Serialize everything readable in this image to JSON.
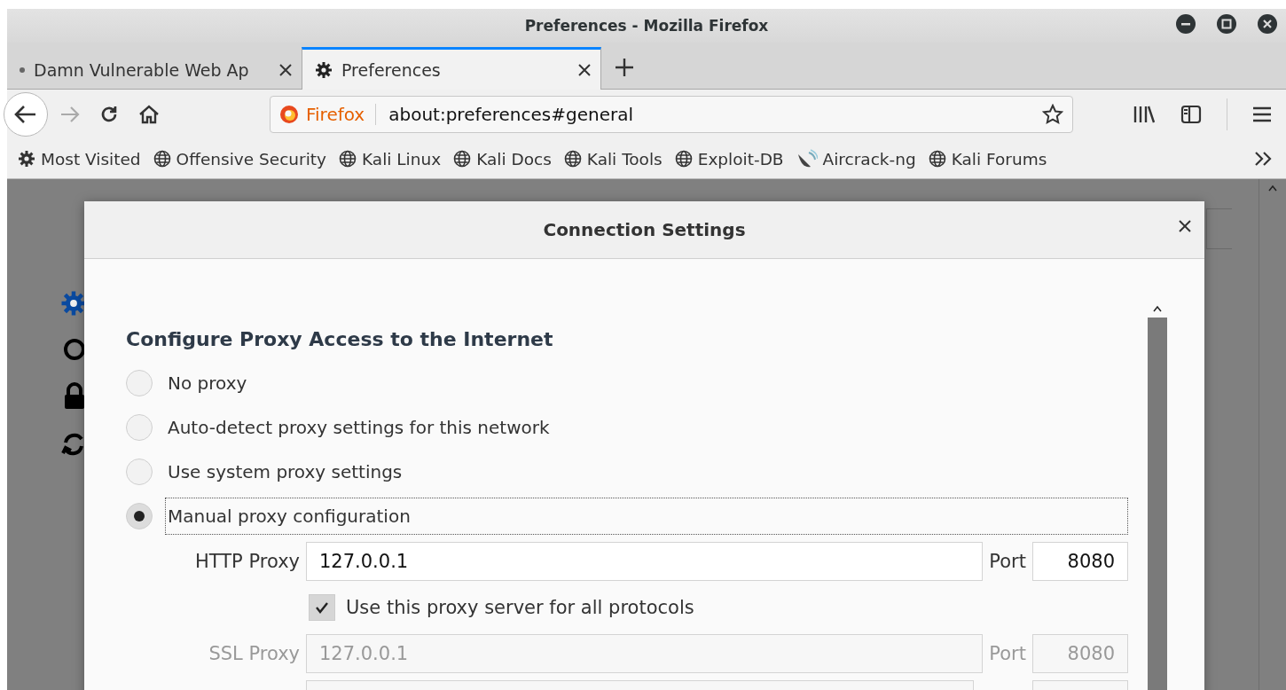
{
  "window": {
    "title": "Preferences - Mozilla Firefox"
  },
  "tabs": [
    {
      "label": "Damn Vulnerable Web Ap",
      "kind": "page",
      "selected": false
    },
    {
      "label": "Preferences",
      "kind": "settings",
      "selected": true
    }
  ],
  "address_bar": {
    "identity": "Firefox",
    "url": "about:preferences#general"
  },
  "bookmarks": [
    {
      "label": "Most Visited",
      "kind": "gear"
    },
    {
      "label": "Offensive Security",
      "kind": "globe"
    },
    {
      "label": "Kali Linux",
      "kind": "globe"
    },
    {
      "label": "Kali Docs",
      "kind": "globe"
    },
    {
      "label": "Kali Tools",
      "kind": "globe"
    },
    {
      "label": "Exploit-DB",
      "kind": "globe"
    },
    {
      "label": "Aircrack-ng",
      "kind": "dish"
    },
    {
      "label": "Kali Forums",
      "kind": "globe"
    }
  ],
  "dialog": {
    "title": "Connection Settings",
    "heading": "Configure Proxy Access to the Internet",
    "options": [
      {
        "label": "No proxy",
        "selected": false,
        "focused": false
      },
      {
        "label": "Auto-detect proxy settings for this network",
        "selected": false,
        "focused": false
      },
      {
        "label": "Use system proxy settings",
        "selected": false,
        "focused": false
      },
      {
        "label": "Manual proxy configuration",
        "selected": true,
        "focused": true
      }
    ],
    "proxies": [
      {
        "label": "HTTP Proxy",
        "value": "127.0.0.1",
        "port_label": "Port",
        "port": "8080",
        "disabled": false
      },
      {
        "label": "SSL Proxy",
        "value": "127.0.0.1",
        "port_label": "Port",
        "port": "8080",
        "disabled": true
      }
    ],
    "share_all": {
      "label": "Use this proxy server for all protocols",
      "checked": true
    }
  }
}
